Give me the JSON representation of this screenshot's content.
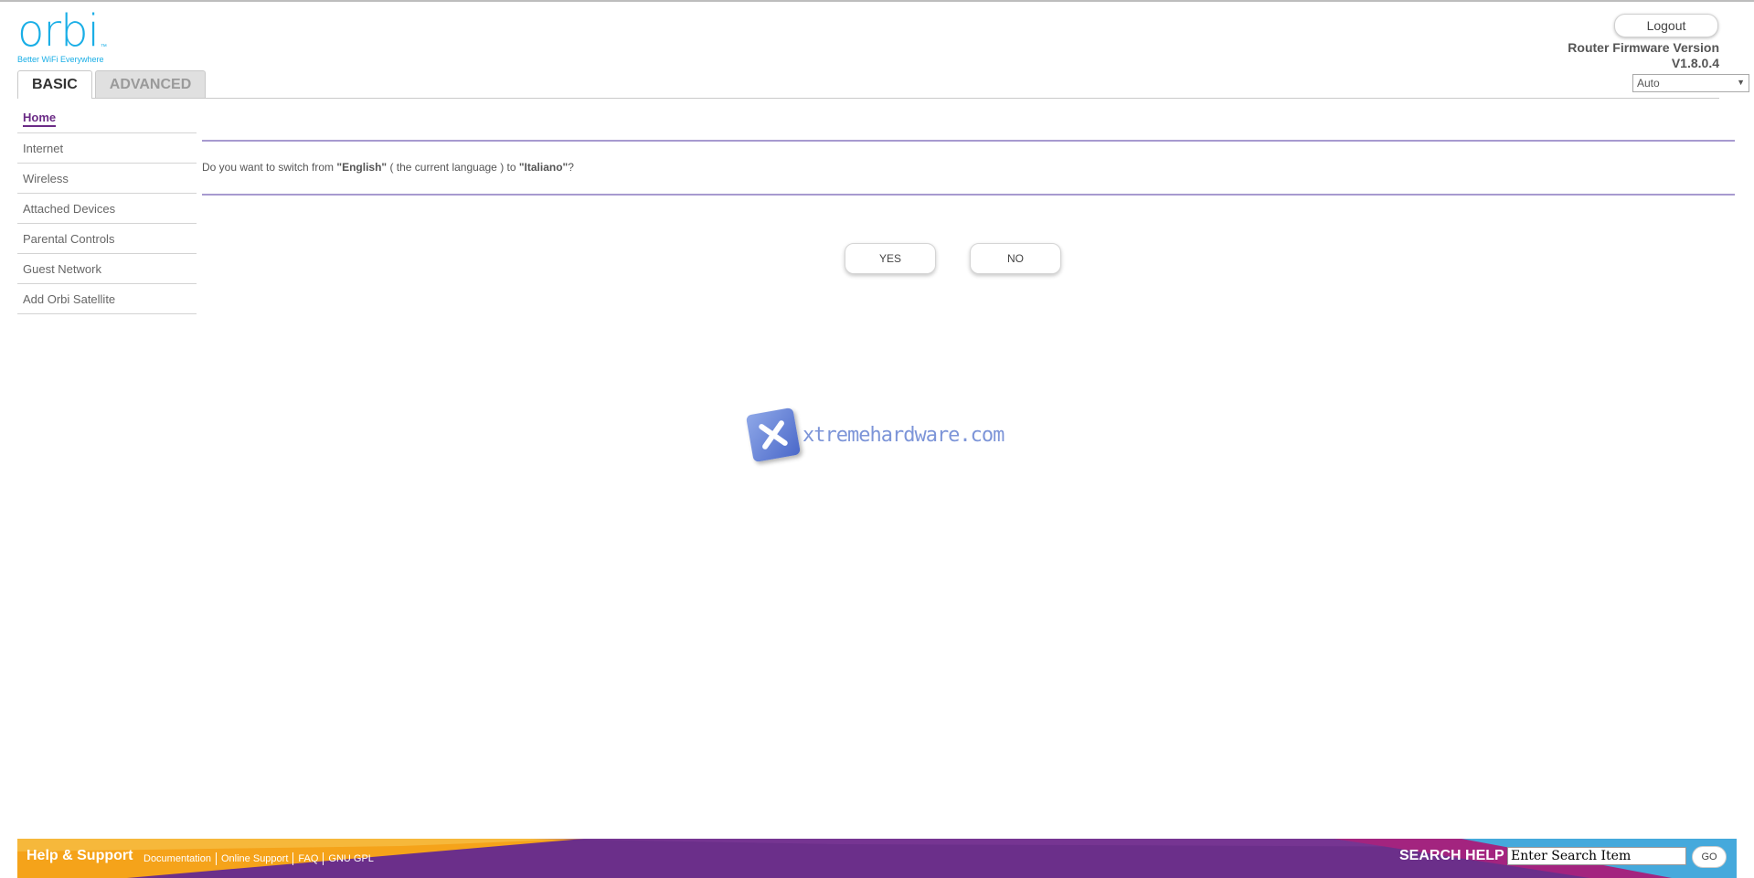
{
  "logo": {
    "word": "orbi",
    "tm": "™",
    "tagline": "Better WiFi Everywhere"
  },
  "tabs": [
    {
      "label": "BASIC",
      "active": true
    },
    {
      "label": "ADVANCED",
      "active": false
    }
  ],
  "header": {
    "logout_label": "Logout",
    "firmware_title": "Router Firmware Version",
    "firmware_version": "V1.8.0.4",
    "language_selected": "Auto"
  },
  "sidebar": {
    "items": [
      {
        "label": "Home",
        "active": true
      },
      {
        "label": "Internet"
      },
      {
        "label": "Wireless"
      },
      {
        "label": "Attached Devices"
      },
      {
        "label": "Parental Controls"
      },
      {
        "label": "Guest Network"
      },
      {
        "label": "Add Orbi Satellite"
      }
    ]
  },
  "dialog": {
    "q_prefix": "Do you want to switch from ",
    "current_lang": "\"English\"",
    "q_middle": " ( the current language ) to ",
    "target_lang": "\"Italiano\"",
    "q_suffix": "?",
    "yes_label": "YES",
    "no_label": "NO"
  },
  "watermark": {
    "text": "xtremehardware.com"
  },
  "footer": {
    "help_title": "Help & Support",
    "links": [
      "Documentation",
      "Online Support",
      "FAQ",
      "GNU GPL"
    ],
    "search_label": "SEARCH HELP",
    "search_value": "Enter Search Item",
    "go_label": "GO"
  },
  "colors": {
    "brand_blue": "#19aee6",
    "purple": "#6b2f8a",
    "rule_purple": "#a79ad0",
    "footer_orange": "#f5a31a",
    "footer_blue": "#45a9dc"
  }
}
